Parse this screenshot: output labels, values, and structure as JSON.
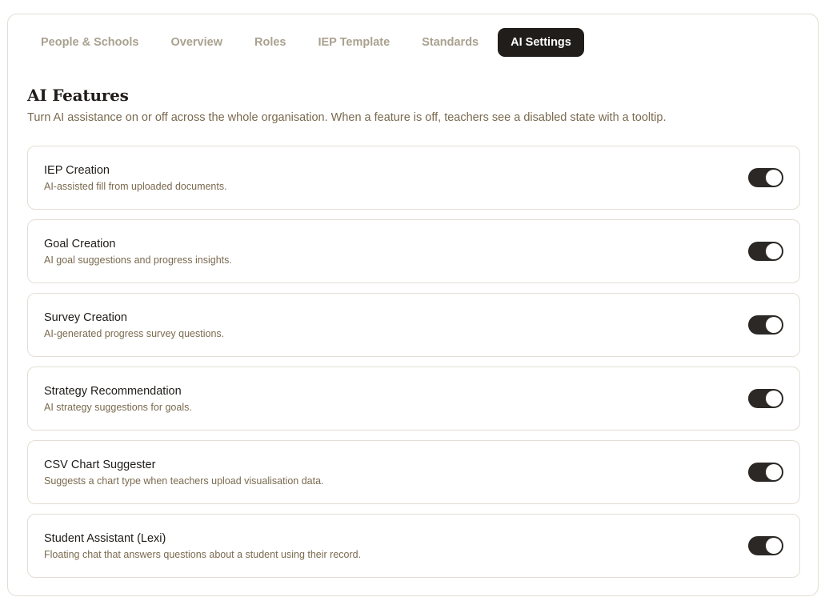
{
  "tabs": [
    {
      "label": "People & Schools",
      "active": false
    },
    {
      "label": "Overview",
      "active": false
    },
    {
      "label": "Roles",
      "active": false
    },
    {
      "label": "IEP Template",
      "active": false
    },
    {
      "label": "Standards",
      "active": false
    },
    {
      "label": "AI Settings",
      "active": true
    }
  ],
  "section": {
    "title": "AI Features",
    "description": "Turn AI assistance on or off across the whole organisation. When a feature is off, teachers see a disabled state with a tooltip."
  },
  "features": [
    {
      "name": "IEP Creation",
      "description": "AI-assisted fill from uploaded documents.",
      "enabled": true
    },
    {
      "name": "Goal Creation",
      "description": "AI goal suggestions and progress insights.",
      "enabled": true
    },
    {
      "name": "Survey Creation",
      "description": "AI-generated progress survey questions.",
      "enabled": true
    },
    {
      "name": "Strategy Recommendation",
      "description": "AI strategy suggestions for goals.",
      "enabled": true
    },
    {
      "name": "CSV Chart Suggester",
      "description": "Suggests a chart type when teachers upload visualisation data.",
      "enabled": true
    },
    {
      "name": "Student Assistant (Lexi)",
      "description": "Floating chat that answers questions about a student using their record.",
      "enabled": true
    }
  ],
  "colors": {
    "accent_dark": "#201d1a",
    "tab_inactive": "#a9a18f",
    "description_text": "#7a6a4f",
    "border": "#e3ded4"
  }
}
